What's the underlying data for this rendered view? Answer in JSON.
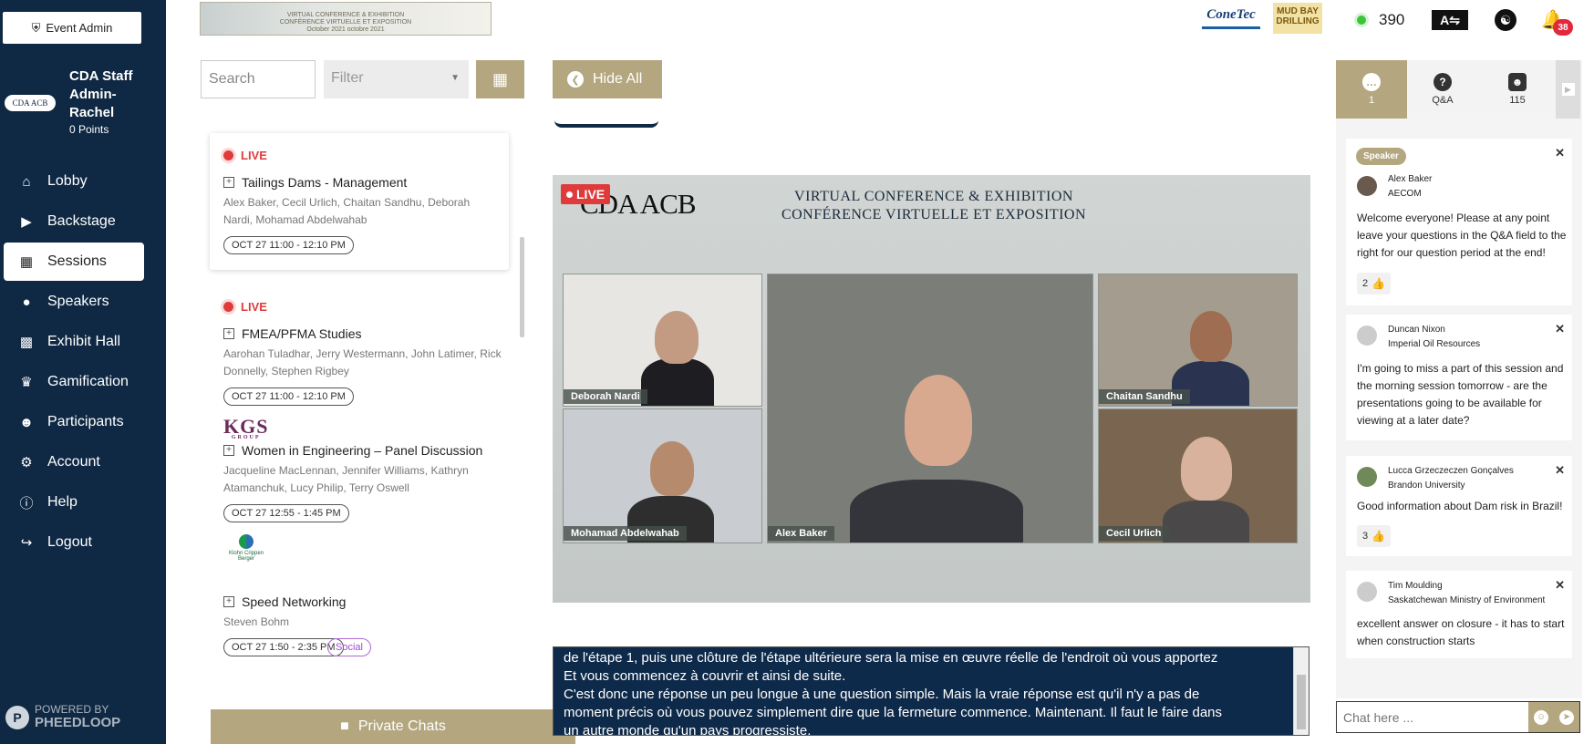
{
  "sidebar": {
    "event_admin": "Event Admin",
    "org_logo": "CDA ACB",
    "user_name": "CDA Staff Admin- Rachel",
    "points": "0 Points",
    "items": [
      {
        "label": "Lobby",
        "icon": "home-icon"
      },
      {
        "label": "Backstage",
        "icon": "video-camera-icon"
      },
      {
        "label": "Sessions",
        "icon": "calendar-icon",
        "active": true
      },
      {
        "label": "Speakers",
        "icon": "user-icon"
      },
      {
        "label": "Exhibit Hall",
        "icon": "building-icon"
      },
      {
        "label": "Gamification",
        "icon": "trophy-icon"
      },
      {
        "label": "Participants",
        "icon": "users-icon"
      },
      {
        "label": "Account",
        "icon": "gear-icon"
      },
      {
        "label": "Help",
        "icon": "info-icon"
      },
      {
        "label": "Logout",
        "icon": "logout-icon"
      }
    ],
    "powered_by": "POWERED BY",
    "powered_name": "PHEEDLOOP"
  },
  "header": {
    "banner_line1": "VIRTUAL CONFERENCE & EXHIBITION",
    "banner_line2": "CONFÉRENCE VIRTUELLE ET EXPOSITION",
    "banner_line3": "October 2021 octobre 2021",
    "sponsor1": "ConeTec",
    "sponsor2": "MUD BAY DRILLING",
    "online_count": "390",
    "notifications": "38"
  },
  "controls": {
    "search_placeholder": "Search",
    "filter_label": "Filter",
    "hide_all": "Hide All"
  },
  "sessions": [
    {
      "live": "LIVE",
      "title": "Tailings Dams - Management",
      "speakers": "Alex Baker, Cecil Urlich, Chaitan Sandhu, Deborah Nardi, Mohamad Abdelwahab",
      "time": "OCT 27 11:00 - 12:10 PM"
    },
    {
      "live": "LIVE",
      "title": "FMEA/PFMA Studies",
      "speakers": "Aarohan Tuladhar, Jerry Westermann, John Latimer, Rick Donnelly, Stephen Rigbey",
      "time": "OCT 27 11:00 - 12:10 PM",
      "sponsor": "KGS",
      "sponsor_sub": "GROUP"
    },
    {
      "title": "Women in Engineering – Panel Discussion",
      "speakers": "Jacqueline MacLennan, Jennifer Williams, Kathryn Atamanchuk, Lucy Philip, Terry Oswell",
      "time": "OCT 27 12:55 - 1:45 PM",
      "sponsor": "Klohn Crippen Berger"
    },
    {
      "title": "Speed Networking",
      "speakers": "Steven Bohm",
      "time": "OCT 27 1:50 - 2:35 PM",
      "tag": "Social"
    }
  ],
  "private_chats": "Private Chats",
  "video": {
    "live": "LIVE",
    "logo": "CDA ACB",
    "header_line1": "VIRTUAL CONFERENCE & EXHIBITION",
    "header_line2": "CONFÉRENCE VIRTUELLE ET EXPOSITION",
    "participants": [
      "Deborah Nardi",
      "Alex Baker",
      "Chaitan Sandhu",
      "Mohamad Abdelwahab",
      "Cecil Urlich"
    ]
  },
  "captions": [
    "de l'étape 1, puis une clôture de l'étape ultérieure sera la mise en œuvre réelle de l'endroit où vous apportez",
    "Et vous commencez à couvrir et ainsi de suite.",
    "C'est donc une réponse un peu longue à une question simple. Mais la vraie réponse est qu'il n'y a pas de",
    "moment précis où vous pouvez simplement dire que la fermeture commence. Maintenant. Il faut le faire dans",
    "un autre monde qu'un pays progressiste."
  ],
  "right_tabs": [
    {
      "label": "1",
      "icon": "chat-icon"
    },
    {
      "label": "Q&A",
      "icon": "question-icon"
    },
    {
      "label": "115",
      "icon": "users-icon"
    }
  ],
  "chat": {
    "speaker_badge": "Speaker",
    "messages": [
      {
        "name": "Alex Baker",
        "org": "AECOM",
        "text": "Welcome everyone! Please at any point leave your questions in the Q&A field to the right for our question period at the end!",
        "likes": "2"
      },
      {
        "name": "Duncan Nixon",
        "org": "Imperial Oil Resources",
        "text": "I'm going to miss a part of this session and the morning session tomorrow - are the presentations going to be available for viewing at a later date?"
      },
      {
        "name": "Lucca Grzeczeczen Gonçalves",
        "org": "Brandon University",
        "text": "Good information about Dam risk in Brazil!",
        "likes": "3"
      },
      {
        "name": "Tim Moulding",
        "org": "Saskatchewan Ministry of Environment",
        "text": "excellent answer on closure - it has to start when construction starts"
      }
    ],
    "input_placeholder": "Chat here ..."
  }
}
